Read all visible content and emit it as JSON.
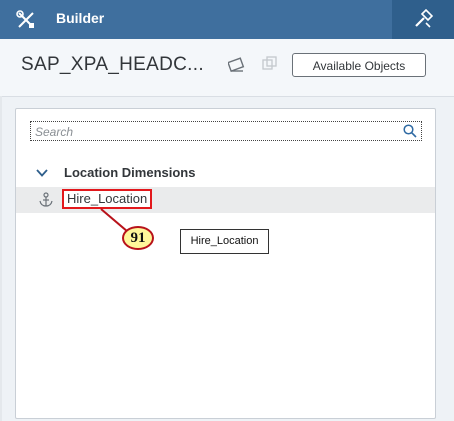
{
  "topbar": {
    "title": "Builder",
    "icons": {
      "tools": "tools-icon",
      "hammer": "hammer-icon"
    }
  },
  "header": {
    "model_name": "SAP_XPA_HEADC...",
    "available_objects_label": "Available Objects",
    "icons": {
      "edit": "edit-icon",
      "copy": "copy-icon"
    }
  },
  "search": {
    "placeholder": "Search",
    "icon": "search-icon"
  },
  "tree": {
    "group_label": "Location Dimensions",
    "group_icon": "chevron-down-icon",
    "items": [
      {
        "label": "Hire_Location",
        "icon": "anchor-icon",
        "selected": true
      }
    ]
  },
  "annotation": {
    "number": "91"
  },
  "tooltip": {
    "text": "Hire_Location"
  },
  "colors": {
    "topbar": "#3f6f9e",
    "highlight": "#e2181c",
    "badge": "#fff79a"
  }
}
